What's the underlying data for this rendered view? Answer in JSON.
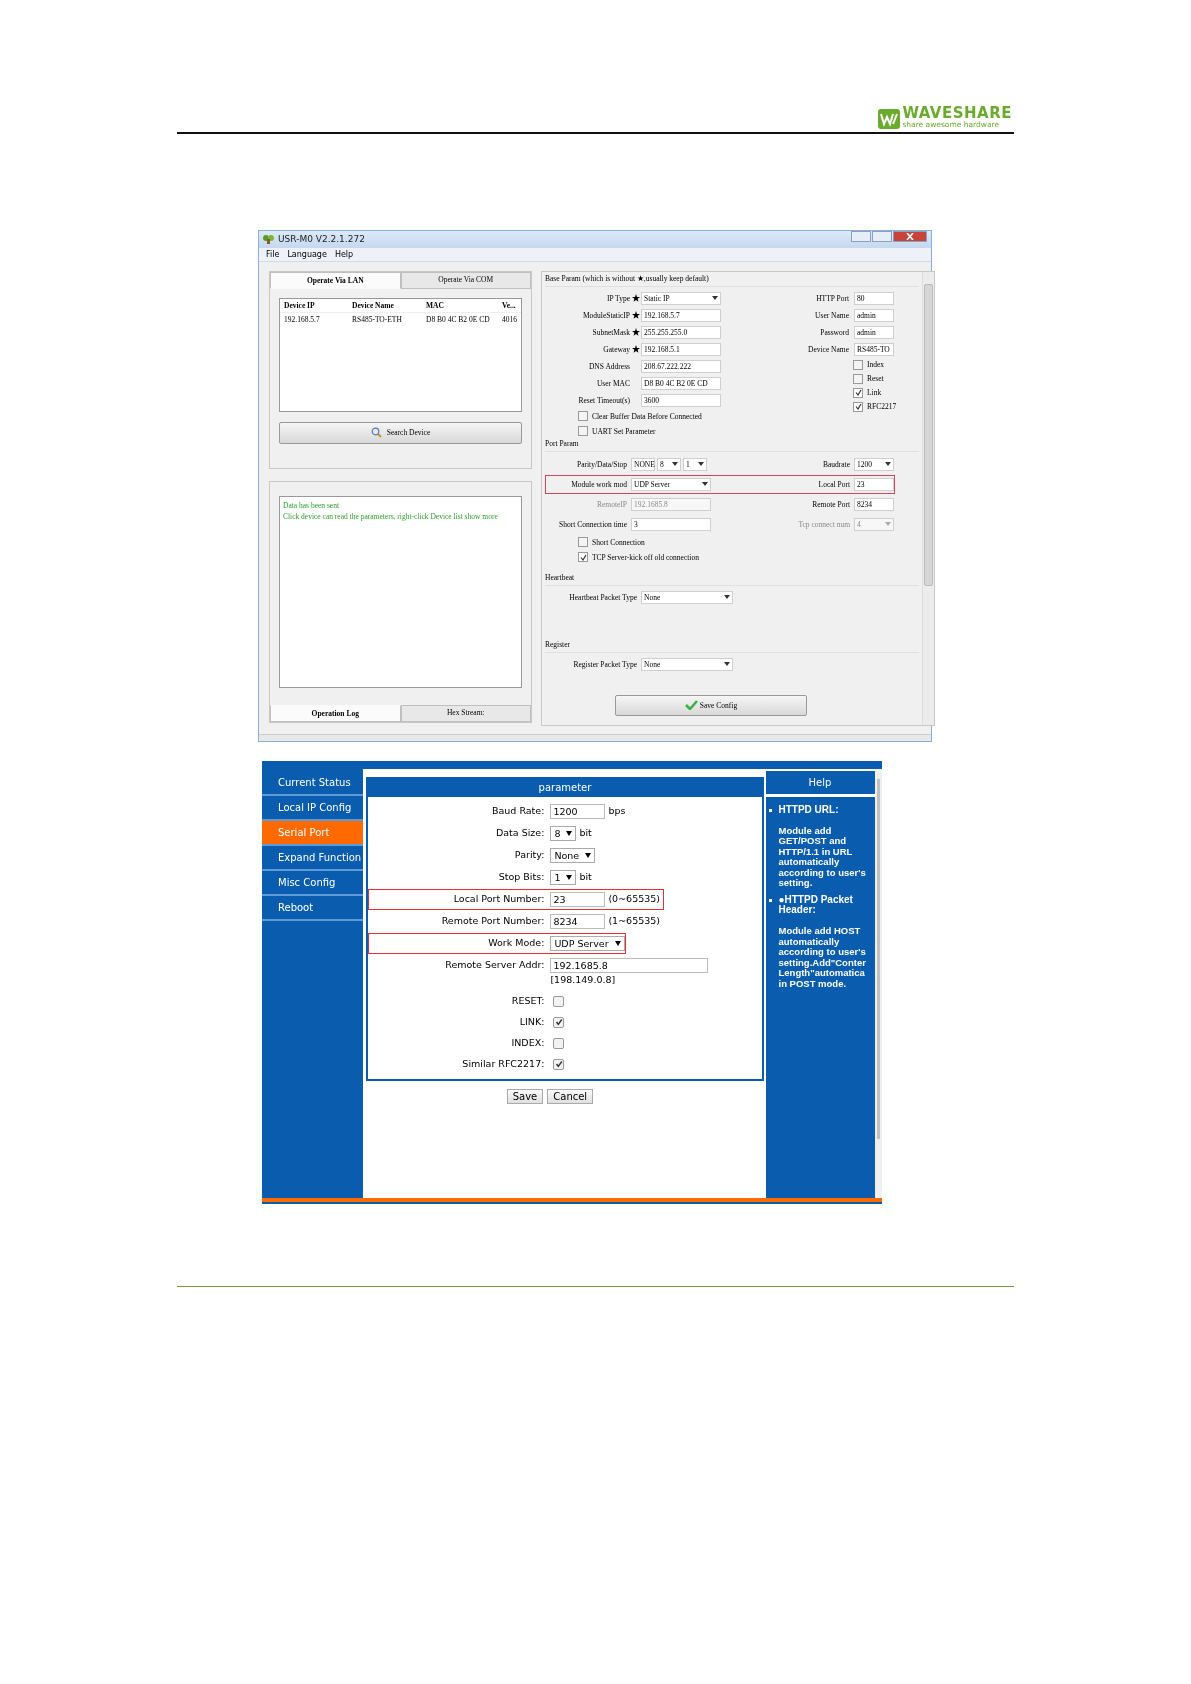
{
  "header": {
    "brand": "WAVESHARE",
    "tagline": "share awesome hardware"
  },
  "config_tool": {
    "title": "USR-M0 V2.2.1.272",
    "menu": [
      "File",
      "Language",
      "Help"
    ],
    "device_tabs": [
      {
        "label": "Operate Via LAN",
        "selected": true
      },
      {
        "label": "Operate Via COM",
        "selected": false
      }
    ],
    "device_table": {
      "columns": [
        "Device IP",
        "Device Name",
        "MAC",
        "Ve..."
      ],
      "rows": [
        [
          "192.168.5.7",
          "RS485-TO-ETH",
          "D8 B0 4C B2 0E CD",
          "4016"
        ]
      ]
    },
    "search_button": "Search Device",
    "log_lines": [
      "Data has been sent",
      "Click device can read the parameters, right-click Device list show more"
    ],
    "log_tabs": [
      {
        "label": "Operation Log",
        "selected": true
      },
      {
        "label": "Hex Stream:",
        "selected": false
      }
    ],
    "base_param": {
      "title": "Base Param (which is without ★,usually keep default)",
      "fields": [
        {
          "label": "IP Type",
          "starred": true,
          "kind": "dropdown",
          "value": "Static IP"
        },
        {
          "label": "ModuleStaticIP",
          "starred": true,
          "kind": "text",
          "value": "192.168.5.7"
        },
        {
          "label": "SubnetMask",
          "starred": true,
          "kind": "text",
          "value": "255.255.255.0"
        },
        {
          "label": "Gateway",
          "starred": true,
          "kind": "text",
          "value": "192.168.5.1"
        },
        {
          "label": "DNS Address",
          "starred": false,
          "kind": "text",
          "value": "208.67.222.222"
        },
        {
          "label": "User MAC",
          "starred": false,
          "kind": "text",
          "value": "D8 B0 4C B2 0E CD"
        },
        {
          "label": "Reset Timeout(s)",
          "starred": false,
          "kind": "text",
          "value": "3600"
        }
      ],
      "checks": [
        {
          "label": "Clear Buffer Data Before Connected",
          "checked": false
        },
        {
          "label": "UART Set Parameter",
          "checked": false
        }
      ],
      "side_fields": [
        {
          "label": "HTTP Port",
          "value": "80"
        },
        {
          "label": "User Name",
          "value": "admin"
        },
        {
          "label": "Password",
          "value": "admin"
        },
        {
          "label": "Device Name",
          "value": "RS485-TO"
        }
      ],
      "side_checks": [
        {
          "label": "Index",
          "checked": false
        },
        {
          "label": "Reset",
          "checked": false
        },
        {
          "label": "Link",
          "checked": true
        },
        {
          "label": "RFC2217",
          "checked": true
        }
      ]
    },
    "port_param": {
      "title": "Port Param",
      "rows": [
        {
          "highlighted": false,
          "left": {
            "label": "Parity/Data/Stop",
            "kind": "multi",
            "values": [
              "NONE",
              "8",
              "1"
            ],
            "disabled": false
          },
          "right": {
            "label": "Baudrate",
            "kind": "dropdown",
            "value": "1200",
            "disabled": false
          }
        },
        {
          "highlighted": true,
          "left": {
            "label": "Module work mod",
            "kind": "dropdown",
            "value": "UDP Server",
            "disabled": false
          },
          "right": {
            "label": "Local Port",
            "kind": "text",
            "value": "23",
            "disabled": false
          }
        },
        {
          "highlighted": false,
          "left": {
            "label": "RemoteIP",
            "kind": "text",
            "value": "192.1685.8",
            "disabled": true
          },
          "right": {
            "label": "Remote Port",
            "kind": "text",
            "value": "8234",
            "disabled": false
          }
        },
        {
          "highlighted": false,
          "left": {
            "label": "Short Connection time",
            "kind": "text",
            "value": "3",
            "disabled": false
          },
          "right": {
            "label": "Tcp connect num",
            "kind": "dropdown",
            "value": "4",
            "disabled": true
          }
        }
      ],
      "checks": [
        {
          "label": "Short Connection",
          "checked": false
        },
        {
          "label": "TCP Server-kick off old connection",
          "checked": true
        }
      ]
    },
    "heartbeat": {
      "title": "Heartbeat",
      "label": "Heartbeat Packet Type",
      "value": "None"
    },
    "register": {
      "title": "Register",
      "label": "Register Packet Type",
      "value": "None"
    },
    "save_button": "Save Config"
  },
  "web_config": {
    "nav": [
      {
        "label": "Current Status",
        "selected": false
      },
      {
        "label": "Local IP Config",
        "selected": false
      },
      {
        "label": "Serial Port",
        "selected": true
      },
      {
        "label": "Expand Function",
        "selected": false
      },
      {
        "label": "Misc Config",
        "selected": false
      },
      {
        "label": "Reboot",
        "selected": false
      }
    ],
    "panel_title": "parameter",
    "rows": [
      {
        "label": "Baud Rate:",
        "kind": "text",
        "value": "1200",
        "unit": "bps",
        "highlighted": false
      },
      {
        "label": "Data Size:",
        "kind": "select",
        "value": "8",
        "unit": "bit",
        "highlighted": false
      },
      {
        "label": "Parity:",
        "kind": "select",
        "value": "None",
        "highlighted": false
      },
      {
        "label": "Stop Bits:",
        "kind": "select",
        "value": "1",
        "unit": "bit",
        "highlighted": false
      },
      {
        "label": "Local Port Number:",
        "kind": "text",
        "value": "23",
        "unit": "(0~65535)",
        "highlighted": true
      },
      {
        "label": "Remote Port Number:",
        "kind": "text",
        "value": "8234",
        "unit": "(1~65535)",
        "highlighted": false
      },
      {
        "label": "Work Mode:",
        "kind": "select",
        "value": "UDP Server",
        "highlighted": true
      },
      {
        "label": "Remote Server Addr:",
        "kind": "wide",
        "value": "192.1685.8",
        "note": "[198.149.0.8]",
        "highlighted": false
      },
      {
        "label": "RESET:",
        "kind": "checkbox",
        "checked": false,
        "highlighted": false
      },
      {
        "label": "LINK:",
        "kind": "checkbox",
        "checked": true,
        "highlighted": false
      },
      {
        "label": "INDEX:",
        "kind": "checkbox",
        "checked": false,
        "highlighted": false
      },
      {
        "label": "Similar RFC2217:",
        "kind": "checkbox",
        "checked": true,
        "highlighted": false
      }
    ],
    "buttons": [
      "Save",
      "Cancel"
    ],
    "help_title": "Help",
    "help_items": [
      {
        "heading": "HTTPD URL:",
        "lines": [
          "Module add",
          "GET/POST and",
          "HTTP/1.1 in URL",
          "automatically",
          "according to user's",
          "setting."
        ]
      },
      {
        "heading": "●HTTPD Packet Header:",
        "lines": [
          "Module add HOST",
          "automatically",
          "according to user's",
          "setting.Add\"Conter",
          "Length\"automatica",
          "in POST mode."
        ]
      }
    ]
  }
}
